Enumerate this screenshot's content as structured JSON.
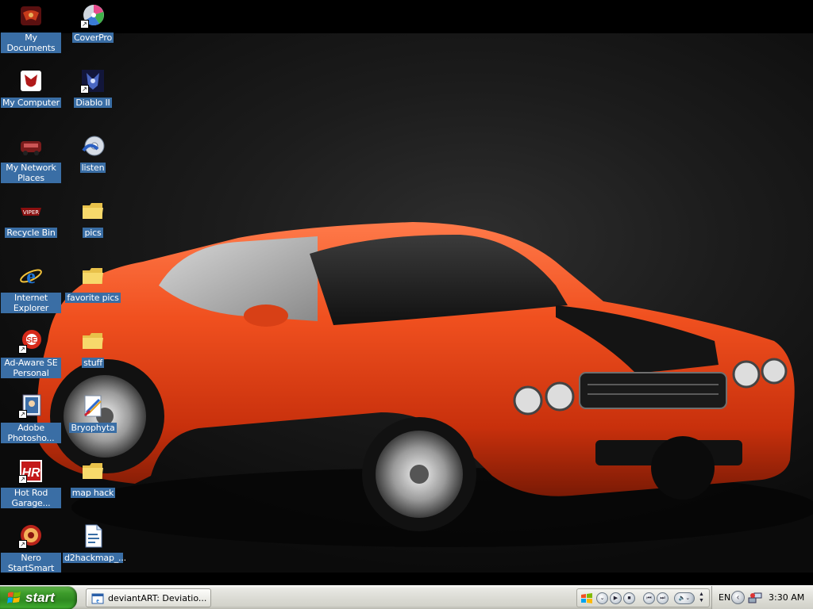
{
  "desktop": {
    "icons": [
      {
        "label": "My Documents",
        "icon": "my-documents-icon",
        "shortcut": false
      },
      {
        "label": "My Computer",
        "icon": "my-computer-icon",
        "shortcut": false
      },
      {
        "label": "My Network Places",
        "icon": "network-places-icon",
        "shortcut": false
      },
      {
        "label": "Recycle Bin",
        "icon": "recycle-bin-icon",
        "shortcut": false
      },
      {
        "label": "Internet Explorer",
        "icon": "internet-explorer-icon",
        "shortcut": false
      },
      {
        "label": "Ad-Aware SE Personal",
        "icon": "ad-aware-icon",
        "shortcut": true
      },
      {
        "label": "Adobe Photosho...",
        "icon": "photoshop-icon",
        "shortcut": true
      },
      {
        "label": "Hot Rod Garage...",
        "icon": "hot-rod-garage-icon",
        "shortcut": true
      },
      {
        "label": "Nero StartSmart",
        "icon": "nero-icon",
        "shortcut": true
      },
      {
        "label": "CoverPro",
        "icon": "coverpro-icon",
        "shortcut": true
      },
      {
        "label": "Diablo II",
        "icon": "diablo-icon",
        "shortcut": true
      },
      {
        "label": "listen",
        "icon": "listen-icon",
        "shortcut": false
      },
      {
        "label": "pics",
        "icon": "folder-icon",
        "shortcut": false
      },
      {
        "label": "favorite pics",
        "icon": "folder-icon",
        "shortcut": false
      },
      {
        "label": "stuff",
        "icon": "folder-icon",
        "shortcut": false
      },
      {
        "label": "Bryophyta",
        "icon": "paint-file-icon",
        "shortcut": false
      },
      {
        "label": "map hack",
        "icon": "folder-icon",
        "shortcut": false
      },
      {
        "label": "d2hackmap_...",
        "icon": "text-file-icon",
        "shortcut": false
      }
    ]
  },
  "taskbar": {
    "start_label": "start",
    "tasks": [
      {
        "label": "deviantART: Deviatio...",
        "icon": "browser-window-icon"
      }
    ],
    "tray": {
      "language": "EN",
      "clock": "3:30 AM"
    }
  },
  "colors": {
    "icon_label_bg": "#3a6ea5",
    "start_green": "#3d9b2b",
    "car_orange": "#e8481a"
  }
}
